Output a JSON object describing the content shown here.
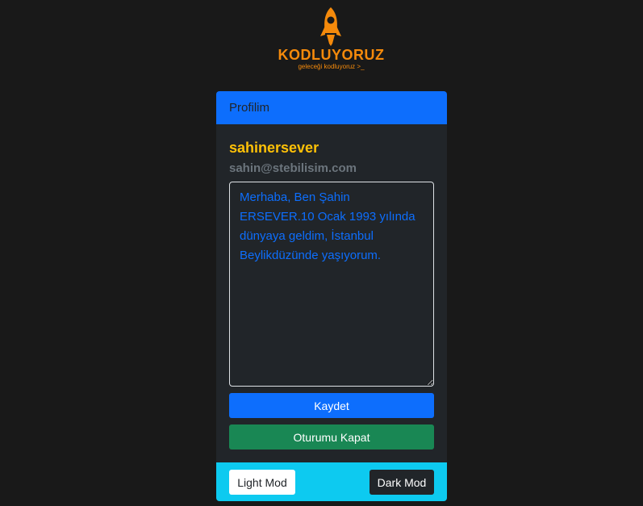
{
  "brand": {
    "name": "KODLUYORUZ",
    "tagline": "geleceği kodluyoruz >_",
    "icon": "rocket-icon",
    "color": "#f58a0b"
  },
  "card": {
    "header": "Profilim",
    "username": "sahinersever",
    "email": "sahin@stebilisim.com",
    "bio": "Merhaba, Ben Şahin ERSEVER.10 Ocak 1993 yılında dünyaya geldim, İstanbul Beylikdüzünde yaşıyorum.",
    "save_label": "Kaydet",
    "logout_label": "Oturumu Kapat",
    "light_mode_label": "Light Mod",
    "dark_mode_label": "Dark Mod"
  },
  "colors": {
    "page_bg": "#191919",
    "card_bg": "#212529",
    "primary": "#0d6efd",
    "success": "#198754",
    "info": "#0dcaf0",
    "warning": "#ffc107",
    "muted": "#6c757d"
  }
}
